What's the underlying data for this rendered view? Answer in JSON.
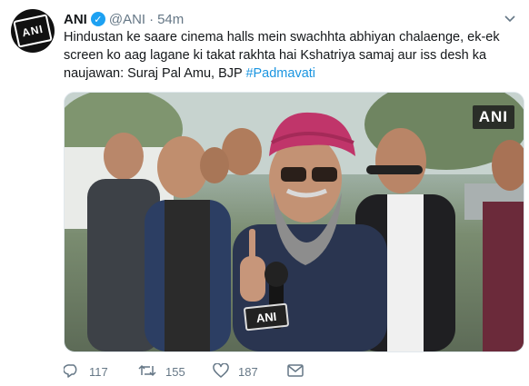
{
  "tweet": {
    "avatar_label": "ANI",
    "display_name": "ANI",
    "handle": "@ANI",
    "separator": "·",
    "time": "54m",
    "text": "Hindustan ke saare cinema halls mein swachhta abhiyan chalaenge, ek-ek screen ko aag lagane ki takat rakhta hai Kshatriya samaj aur iss desh ka naujawan: Suraj Pal Amu, BJP ",
    "hashtag": "#Padmavati",
    "media": {
      "watermark": "ANI",
      "mic_label": "ANI"
    },
    "actions": {
      "reply_count": "117",
      "retweet_count": "155",
      "like_count": "187"
    }
  },
  "colors": {
    "accent": "#1da1f2",
    "hashtag": "#1b95e0",
    "muted": "#657786",
    "text": "#14171a",
    "turban": "#c0356a"
  },
  "icons": [
    "verified-badge-icon",
    "chevron-down-icon",
    "reply-icon",
    "retweet-icon",
    "like-icon",
    "message-icon"
  ]
}
